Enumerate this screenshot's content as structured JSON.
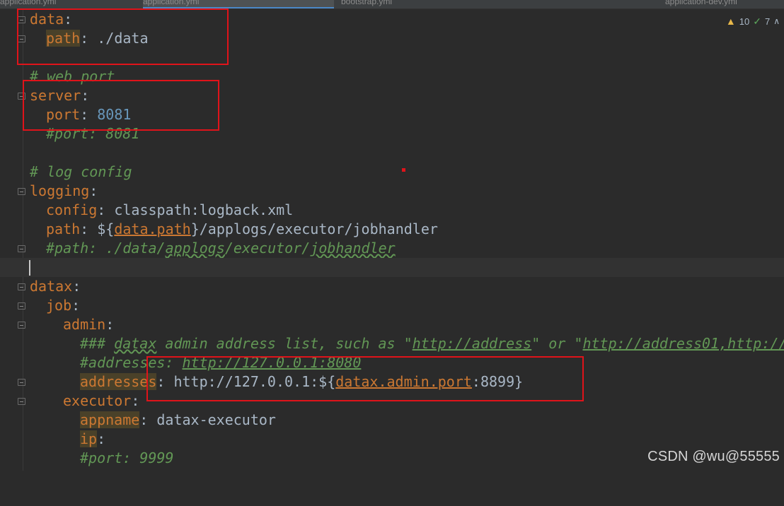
{
  "tabs": [
    {
      "label": "application.yml"
    },
    {
      "label": "application.yml"
    },
    {
      "label": "bootstrap.yml"
    },
    {
      "label": "application-dev.yml"
    }
  ],
  "inspections": {
    "warnings": "10",
    "weak_warnings": "7"
  },
  "code": {
    "l1_key": "data",
    "l1_colon": ":",
    "l2_key": "path",
    "l2_rest": ": ./data",
    "l4_comment": "# web port",
    "l5_key": "server",
    "l5_colon": ":",
    "l6_key": "port",
    "l6_colon": ": ",
    "l6_val": "8081",
    "l7_comment": "#port: 8081",
    "l9_comment": "# log config",
    "l10_key": "logging",
    "l10_colon": ":",
    "l11_key": "config",
    "l11_rest": ": classpath:logback.xml",
    "l12_key": "path",
    "l12_pre": ": ${",
    "l12_ref": "data.path",
    "l12_post": "}/applogs/executor/jobhandler",
    "l13_a": "#path: ./data/",
    "l13_b": "applogs",
    "l13_c": "/executor/",
    "l13_d": "jobhandler",
    "l15_key": "datax",
    "l15_colon": ":",
    "l16_key": "job",
    "l16_colon": ":",
    "l17_key": "admin",
    "l17_colon": ":",
    "l18_a": "### ",
    "l18_b": "datax",
    "l18_c": " admin address list, such as \"",
    "l18_d": "http://address",
    "l18_e": "\" or \"",
    "l18_f": "http://address01,http://",
    "l19_a": "#addresses: ",
    "l19_b": "http://127.0.0.1:8080",
    "l20_key": "addresses",
    "l20_pre": ": http://127.0.0.1:${",
    "l20_ref": "datax.admin.port",
    "l20_post": ":8899}",
    "l21_key": "executor",
    "l21_colon": ":",
    "l22_key": "appname",
    "l22_rest": ": datax-executor",
    "l23_key": "ip",
    "l23_colon": ":",
    "l24_comment": "#port: 9999"
  },
  "watermark": "CSDN @wu@55555",
  "colors": {
    "background": "#2b2b2b",
    "key": "#cc7832",
    "number": "#6897bb",
    "comment": "#629755",
    "text": "#a9b7c6",
    "annotation": "#e0131a"
  }
}
